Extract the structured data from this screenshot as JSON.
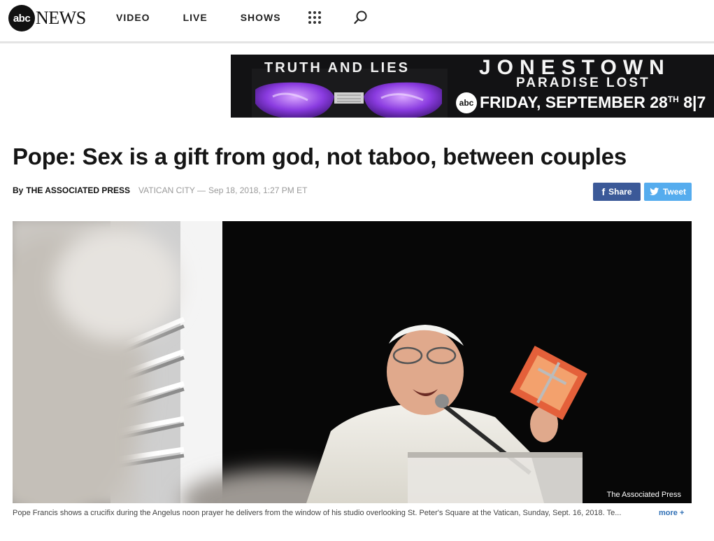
{
  "header": {
    "logo_circle": "abc",
    "logo_news": "NEWS",
    "nav": [
      "VIDEO",
      "LIVE",
      "SHOWS"
    ]
  },
  "banner": {
    "left_text": "TRUTH AND LIES",
    "title": "JONESTOWN",
    "subtitle": "PARADISE LOST",
    "network": "abc",
    "date_main": "FRIDAY, SEPTEMBER 28",
    "date_sup": "TH",
    "date_time": " 8|7"
  },
  "article": {
    "headline": "Pope: Sex is a gift from god, not taboo, between couples",
    "by_prefix": "By",
    "author": "THE ASSOCIATED PRESS",
    "location": "VATICAN CITY —",
    "date": "Sep 18, 2018, 1:27 PM ET",
    "share_facebook": "Share",
    "share_twitter": "Tweet",
    "photo_credit": "The Associated Press",
    "caption": "Pope Francis shows a crucifix during the Angelus noon prayer he delivers from the window of his studio overlooking St. Peter's Square at the Vatican, Sunday, Sept. 16, 2018. Te...",
    "more_label": "more +"
  },
  "colors": {
    "facebook": "#3b5998",
    "twitter": "#55acee",
    "link": "#2f6fb5"
  }
}
